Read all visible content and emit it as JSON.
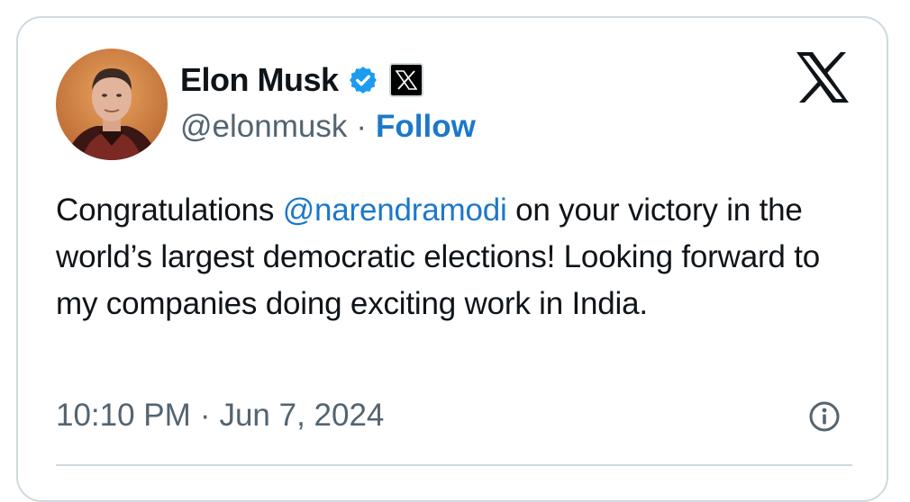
{
  "tweet": {
    "author": {
      "display_name": "Elon Musk",
      "handle": "@elonmusk",
      "verified_icon": "verified-badge-icon",
      "affiliate_icon": "x-affiliate-badge-icon"
    },
    "separator": "·",
    "follow_label": "Follow",
    "body": {
      "before_mention": "Congratulations ",
      "mention": "@narendramodi",
      "after_mention": " on your victory in the world’s largest democratic elections! Looking forward to my companies doing exciting work in India."
    },
    "time": "10:10 PM",
    "date": "Jun 7, 2024",
    "brand_icon": "x-logo-icon",
    "info_icon": "info-icon"
  },
  "colors": {
    "accent": "#1d78c9",
    "verified": "#1d9bf0",
    "secondary_text": "#536471",
    "border": "#cfd9de"
  }
}
